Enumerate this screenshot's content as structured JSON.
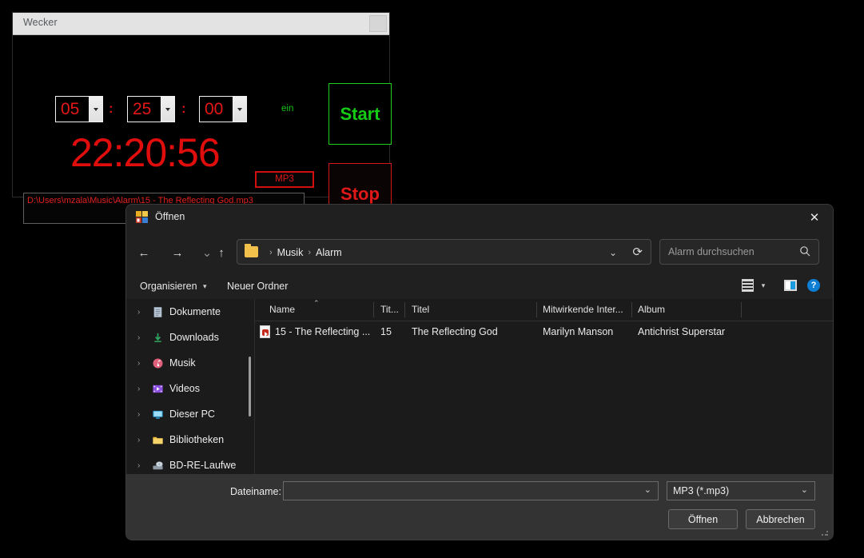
{
  "alarm_window": {
    "title": "Wecker",
    "sys_button": "",
    "hours": "05",
    "minutes": "25",
    "seconds": "00",
    "colon1": ":",
    "colon2": ":",
    "enabled_label": "ein",
    "current_time": "22:20:56",
    "mp3_button": "MP3",
    "file_path": "D:\\Users\\mzala\\Music\\Alarm\\15 - The Reflecting God.mp3",
    "start_button": "Start",
    "stop_button": "Stop",
    "colors": {
      "red": "#e41717",
      "green": "#15cc15",
      "titlebar": "#e3e3e3"
    }
  },
  "dialog": {
    "title": "Öffnen",
    "app_icon": "windows-explorer-icon",
    "close_icon": "✕",
    "nav": {
      "back_icon": "←",
      "forward_icon": "→",
      "recent_icon": "⌄",
      "up_icon": "↑"
    },
    "breadcrumb": {
      "folder_icon": "folder-icon",
      "separator": "›",
      "items": [
        "Musik",
        "Alarm"
      ],
      "dropdown_icon": "⌄",
      "refresh_icon": "⟳"
    },
    "search": {
      "placeholder": "Alarm durchsuchen",
      "icon": "search-icon"
    },
    "toolbar": {
      "organize_label": "Organisieren",
      "organize_chevron": "▾",
      "new_folder_label": "Neuer Ordner",
      "view_icon": "view-list-icon",
      "view_chevron": "▾",
      "preview_icon": "preview-pane-icon",
      "help_icon": "?"
    },
    "tree": {
      "items": [
        {
          "label": "Dokumente",
          "icon": "documents-icon",
          "chevron": "›"
        },
        {
          "label": "Downloads",
          "icon": "downloads-icon",
          "chevron": "›"
        },
        {
          "label": "Musik",
          "icon": "music-icon",
          "chevron": "›"
        },
        {
          "label": "Videos",
          "icon": "videos-icon",
          "chevron": "›"
        },
        {
          "label": "Dieser PC",
          "icon": "this-pc-icon",
          "chevron": "›"
        },
        {
          "label": "Bibliotheken",
          "icon": "libraries-icon",
          "chevron": "›"
        },
        {
          "label": "BD-RE-Laufwe",
          "icon": "bd-re-drive-icon",
          "chevron": "›"
        }
      ]
    },
    "filelist": {
      "columns": [
        "Name",
        "Tit...",
        "Titel",
        "Mitwirkende Inter...",
        "Album"
      ],
      "sort_indicator": "⌃",
      "rows": [
        {
          "icon": "mp3-file-icon",
          "name": "15 - The Reflecting ...",
          "track": "15",
          "title": "The Reflecting God",
          "artist": "Marilyn Manson",
          "album": "Antichrist Superstar"
        }
      ]
    },
    "footer": {
      "filename_label": "Dateiname:",
      "filename_value": "",
      "filename_chevron": "⌄",
      "filetype_value": "MP3 (*.mp3)",
      "filetype_chevron": "⌄",
      "open_button": "Öffnen",
      "cancel_button": "Abbrechen"
    }
  }
}
